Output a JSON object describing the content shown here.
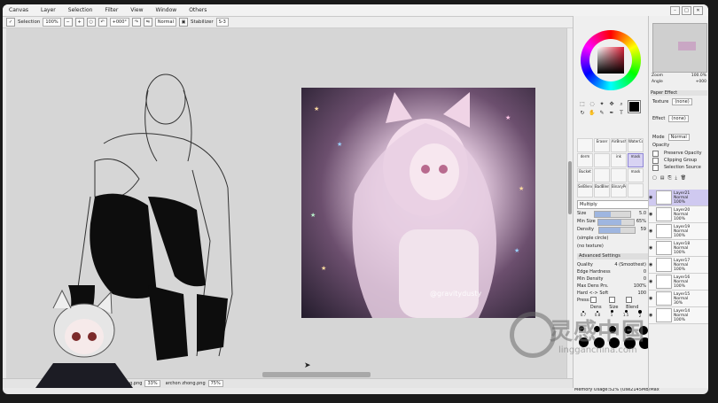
{
  "menu": [
    "Canvas",
    "Layer",
    "Selection",
    "Filter",
    "View",
    "Window",
    "Others"
  ],
  "toolbar": {
    "selection_label": "Selection",
    "zoom": "100%",
    "angle": "+000°",
    "blend": "Normal",
    "stabilizer_label": "Stabilizer",
    "stabilizer_value": "S-3"
  },
  "canvas": {
    "watermark": "@gravitydusty"
  },
  "status": {
    "tabs": [
      {
        "name": "ng.png",
        "zoom": "33%"
      },
      {
        "name": "archon zhong.png",
        "zoom": "75%"
      }
    ],
    "memory": "Memory Usage:52% (Use2145MB/Max"
  },
  "navigator": {
    "zoom_label": "Zoom",
    "zoom_value": "100.0%",
    "angle_label": "Angle",
    "angle_value": "+000"
  },
  "paper_effect": {
    "title": "Paper Effect",
    "texture_label": "Texture",
    "texture_value": "(none)",
    "effect_label": "Effect",
    "effect_value": "(none)"
  },
  "layer_props": {
    "mode_label": "Mode",
    "mode_value": "Normal",
    "opacity_label": "Opacity",
    "preserve_opacity": "Preserve Opacity",
    "clipping_group": "Clipping Group",
    "selection_source": "Selection Source"
  },
  "layers": [
    {
      "name": "Layer21",
      "mode": "Normal",
      "opacity": "100%",
      "selected": true
    },
    {
      "name": "Layer20",
      "mode": "Normal",
      "opacity": "100%",
      "selected": false
    },
    {
      "name": "Layer19",
      "mode": "Normal",
      "opacity": "100%",
      "selected": false
    },
    {
      "name": "Layer18",
      "mode": "Normal",
      "opacity": "100%",
      "selected": false
    },
    {
      "name": "Layer17",
      "mode": "Normal",
      "opacity": "100%",
      "selected": false
    },
    {
      "name": "Layer16",
      "mode": "Normal",
      "opacity": "100%",
      "selected": false
    },
    {
      "name": "Layer15",
      "mode": "Normal",
      "opacity": "30%",
      "selected": false
    },
    {
      "name": "Layer14",
      "mode": "Normal",
      "opacity": "100%",
      "selected": false
    }
  ],
  "brush_tools": [
    {
      "label": "",
      "selected": false
    },
    {
      "label": "Eraser",
      "selected": false
    },
    {
      "label": "AirBrush",
      "selected": false
    },
    {
      "label": "WaterCo",
      "selected": false
    },
    {
      "label": "derm",
      "selected": false
    },
    {
      "label": "",
      "selected": false
    },
    {
      "label": "ink",
      "selected": false
    },
    {
      "label": "mask",
      "selected": true
    },
    {
      "label": "Bucket",
      "selected": false
    },
    {
      "label": "",
      "selected": false
    },
    {
      "label": "",
      "selected": false
    },
    {
      "label": "mask",
      "selected": false
    },
    {
      "label": "SelBlend",
      "selected": false
    },
    {
      "label": "BadBlen",
      "selected": false
    },
    {
      "label": "BinaryPe",
      "selected": false
    },
    {
      "label": "",
      "selected": false
    }
  ],
  "brush_props": {
    "blend": "Multiply",
    "size_label": "Size",
    "size_value": "5.0",
    "minsize_label": "Min Size",
    "minsize_value": "65%",
    "density_label": "Density",
    "density_value": "59",
    "shape": "(simple circle)",
    "texture": "(no texture)"
  },
  "advanced": {
    "title": "Advanced Settings",
    "quality_label": "Quality",
    "quality_value": "4 (Smoothest)",
    "edge_label": "Edge Hardness",
    "edge_value": "0",
    "min_density_label": "Min Density",
    "min_density_value": "0",
    "max_dens_label": "Max Dens Prs.",
    "max_dens_value": "100%",
    "hard_soft_label": "Hard <-> Soft",
    "hard_soft_value": "100",
    "press_label": "Press:",
    "press_dens": "Dens",
    "press_size": "Size",
    "press_blend": "Blend"
  },
  "size_presets": [
    "0.7",
    "0.8",
    "1",
    "1.5",
    "2"
  ],
  "brand": {
    "name": "灵感中国",
    "url": "lingganchina.com"
  }
}
